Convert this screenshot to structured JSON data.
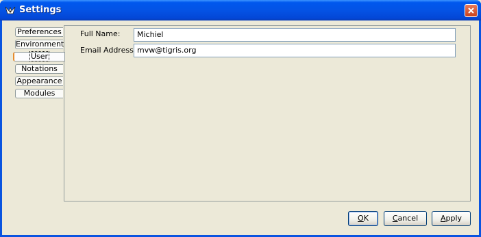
{
  "window": {
    "title": "Settings"
  },
  "tabs": [
    {
      "label": "Preferences",
      "selected": false
    },
    {
      "label": "Environment",
      "selected": false
    },
    {
      "label": "User",
      "selected": true
    },
    {
      "label": "Notations",
      "selected": false
    },
    {
      "label": "Appearance",
      "selected": false
    },
    {
      "label": "Modules",
      "selected": false
    }
  ],
  "user_form": {
    "full_name_label": "Full Name:",
    "full_name_value": "Michiel",
    "email_label": "Email Address:",
    "email_value": "mvw@tigris.org"
  },
  "buttons": {
    "ok": {
      "mnemonic": "O",
      "rest": "K"
    },
    "cancel": {
      "mnemonic": "C",
      "rest": "ancel"
    },
    "apply": {
      "mnemonic": "A",
      "rest": "pply"
    }
  },
  "colors": {
    "title_bar": "#0453e5",
    "dialog_bg": "#ece9d8",
    "selected_tab_accent": "#e68b2c"
  },
  "icons": {
    "app": "argouml-icon",
    "close": "close-icon"
  }
}
